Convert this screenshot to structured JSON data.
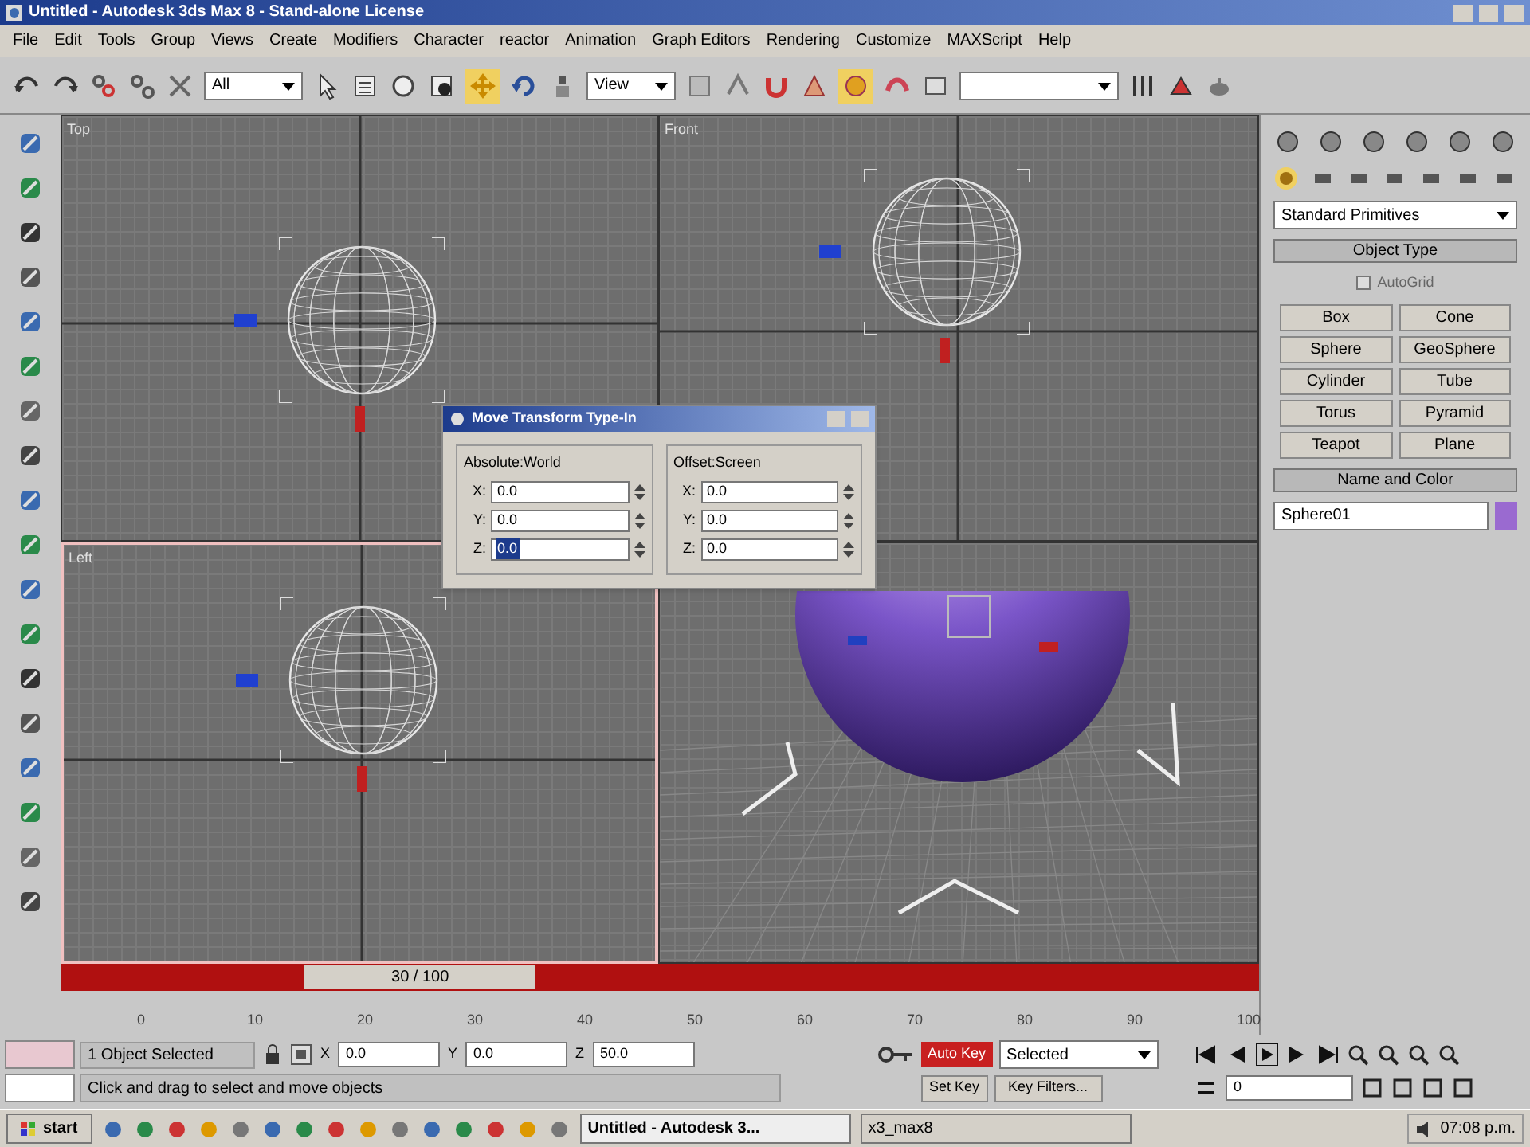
{
  "window": {
    "title": "Untitled - Autodesk 3ds Max 8 - Stand-alone License"
  },
  "menu": [
    "File",
    "Edit",
    "Tools",
    "Group",
    "Views",
    "Create",
    "Modifiers",
    "Character",
    "reactor",
    "Animation",
    "Graph Editors",
    "Rendering",
    "Customize",
    "MAXScript",
    "Help"
  ],
  "toolbar": {
    "selection_filter": "All",
    "reference_coord": "View"
  },
  "viewports": [
    {
      "label": "Top",
      "kind": "top",
      "active": false
    },
    {
      "label": "Front",
      "kind": "front",
      "active": false
    },
    {
      "label": "Left",
      "kind": "left",
      "active": true
    },
    {
      "kind": "perspective",
      "active": false
    }
  ],
  "dialog": {
    "title": "Move Transform Type-In",
    "groups": [
      {
        "label": "Absolute:World",
        "fields": [
          {
            "axis": "X:",
            "value": "0.0",
            "selected": false
          },
          {
            "axis": "Y:",
            "value": "0.0",
            "selected": false
          },
          {
            "axis": "Z:",
            "value": "0.0",
            "selected": true
          }
        ]
      },
      {
        "label": "Offset:Screen",
        "fields": [
          {
            "axis": "X:",
            "value": "0.0",
            "selected": false
          },
          {
            "axis": "Y:",
            "value": "0.0",
            "selected": false
          },
          {
            "axis": "Z:",
            "value": "0.0",
            "selected": false
          }
        ]
      }
    ]
  },
  "command_panel": {
    "dropdown": "Standard Primitives",
    "object_type": {
      "title": "Object Type",
      "autogrid": "AutoGrid",
      "autogrid_checked": false,
      "buttons": [
        "Box",
        "Cone",
        "Sphere",
        "GeoSphere",
        "Cylinder",
        "Tube",
        "Torus",
        "Pyramid",
        "Teapot",
        "Plane"
      ]
    },
    "name_and_color": {
      "title": "Name and Color",
      "name": "Sphere01",
      "color": "#9a6ad0"
    }
  },
  "timeline": {
    "slider": "30 / 100",
    "level": 0.3,
    "ticks": [
      "0",
      "10",
      "20",
      "30",
      "40",
      "50",
      "60",
      "70",
      "80",
      "90",
      "100"
    ]
  },
  "status": {
    "selection": "1 Object Selected",
    "prompt": "Click and drag to select and move objects",
    "coords": [
      {
        "axis": "X",
        "value": "0.0"
      },
      {
        "axis": "Y",
        "value": "0.0"
      },
      {
        "axis": "Z",
        "value": "50.0"
      }
    ],
    "auto_key": "Auto Key",
    "key_mode": "Selected",
    "set_key": "Set Key",
    "key_filters": "Key Filters...",
    "frame": "0"
  },
  "taskbar": {
    "start": "start",
    "tasks": [
      {
        "label": "Untitled - Autodesk 3...",
        "selected": true
      },
      {
        "label": "x3_max8",
        "selected": false
      }
    ],
    "clock": "07:08 p.m."
  }
}
